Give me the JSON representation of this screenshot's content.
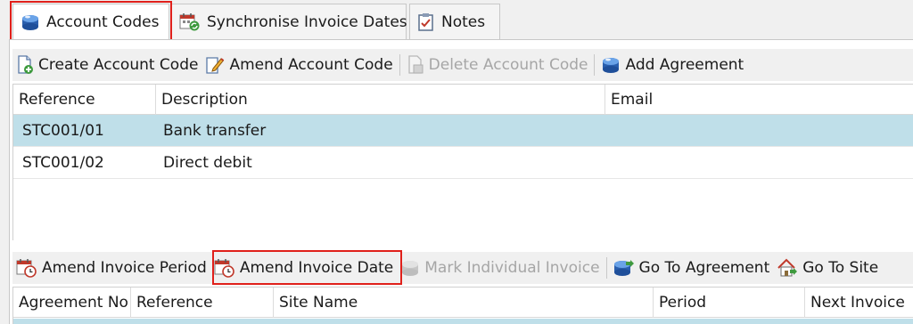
{
  "tabs": [
    {
      "label": "Account Codes",
      "icon": "account-codes-icon",
      "active": true
    },
    {
      "label": "Synchronise Invoice Dates",
      "icon": "calendar-sync-icon",
      "active": false
    },
    {
      "label": "Notes",
      "icon": "notes-icon",
      "active": false
    }
  ],
  "toolbar_top": {
    "create": "Create Account Code",
    "amend": "Amend Account Code",
    "delete": "Delete Account Code",
    "add_agreement": "Add Agreement"
  },
  "accounts_grid": {
    "columns": [
      "Reference",
      "Description",
      "Email"
    ],
    "rows": [
      {
        "reference": "STC001/01",
        "description": "Bank transfer",
        "email": "",
        "selected": true
      },
      {
        "reference": "STC001/02",
        "description": "Direct debit",
        "email": "",
        "selected": false
      }
    ]
  },
  "toolbar_bottom": {
    "amend_period": "Amend Invoice Period",
    "amend_date": "Amend Invoice Date",
    "mark_individual": "Mark Individual Invoice",
    "go_agreement": "Go To Agreement",
    "go_site": "Go To Site"
  },
  "agreements_grid": {
    "columns": [
      "Agreement No",
      "Reference",
      "Site Name",
      "Period",
      "Next Invoice"
    ]
  },
  "colors": {
    "highlight": "#e0201b",
    "selection": "#bfdfe9",
    "disabled_text": "#a6a6a6"
  }
}
